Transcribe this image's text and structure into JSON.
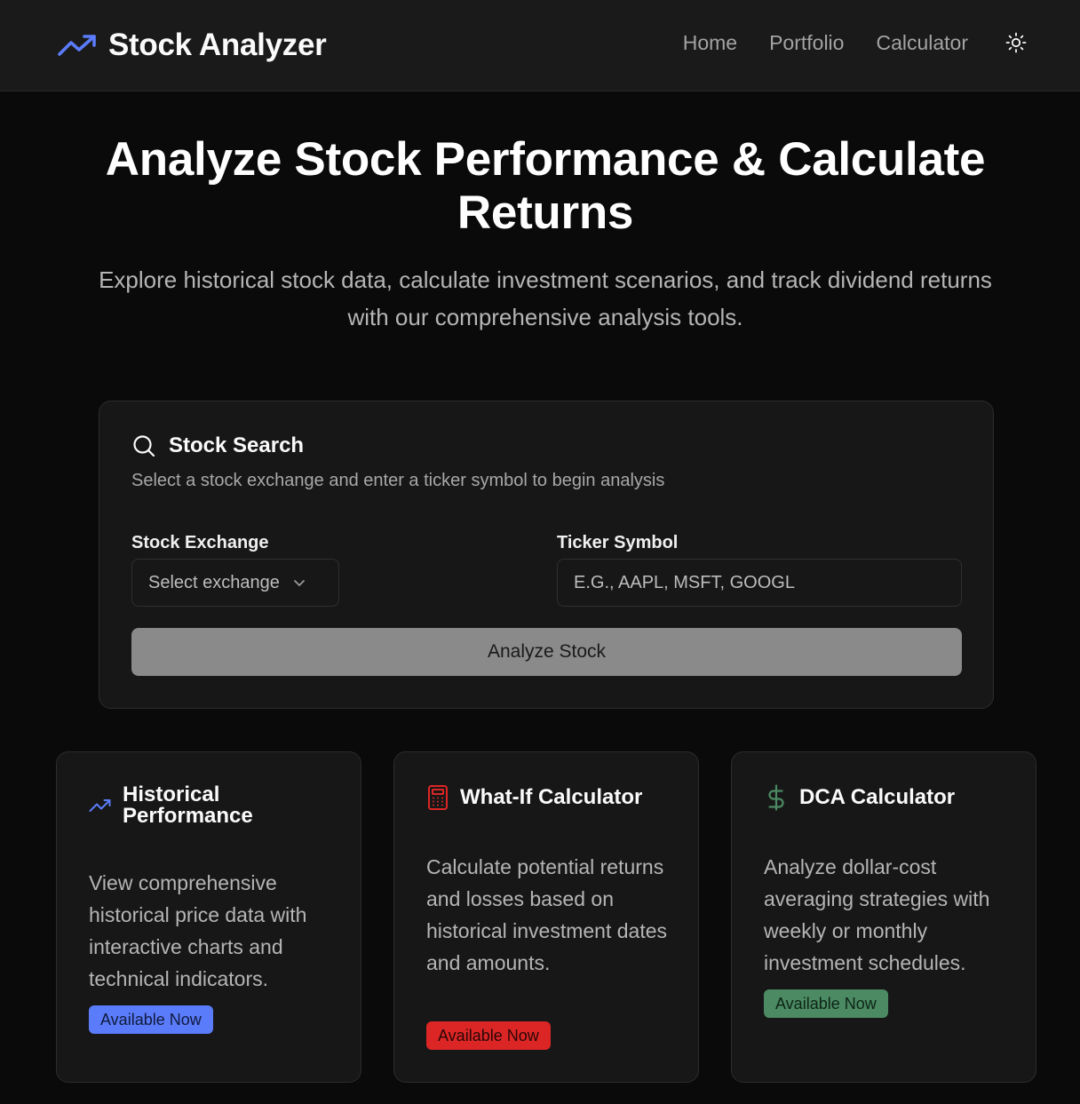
{
  "brand": {
    "title": "Stock Analyzer",
    "accent": "#5b7cfa"
  },
  "nav": {
    "links": [
      "Home",
      "Portfolio",
      "Calculator"
    ],
    "theme_icon": "sun-icon"
  },
  "hero": {
    "title": "Analyze Stock Performance & Calculate Returns",
    "subtitle": "Explore historical stock data, calculate investment scenarios, and track dividend returns with our comprehensive analysis tools."
  },
  "search": {
    "title": "Stock Search",
    "description": "Select a stock exchange and enter a ticker symbol to begin analysis",
    "exchange_label": "Stock Exchange",
    "exchange_placeholder": "Select exchange",
    "ticker_label": "Ticker Symbol",
    "ticker_placeholder": "E.G., AAPL, MSFT, GOOGL",
    "button_label": "Analyze Stock"
  },
  "features": [
    {
      "icon": "trending-up-icon",
      "title": "Historical Performance",
      "description": "View comprehensive historical price data with interactive charts and technical indicators.",
      "badge": "Available Now",
      "badge_color": "#5b7cfa"
    },
    {
      "icon": "calculator-icon",
      "title": "What-If Calculator",
      "description": "Calculate potential returns and losses based on historical investment dates and amounts.",
      "badge": "Available Now",
      "badge_color": "#dc2626"
    },
    {
      "icon": "dollar-icon",
      "title": "DCA Calculator",
      "description": "Analyze dollar-cost averaging strategies with weekly or monthly investment schedules.",
      "badge": "Available Now",
      "badge_color": "#4b8a63"
    }
  ]
}
